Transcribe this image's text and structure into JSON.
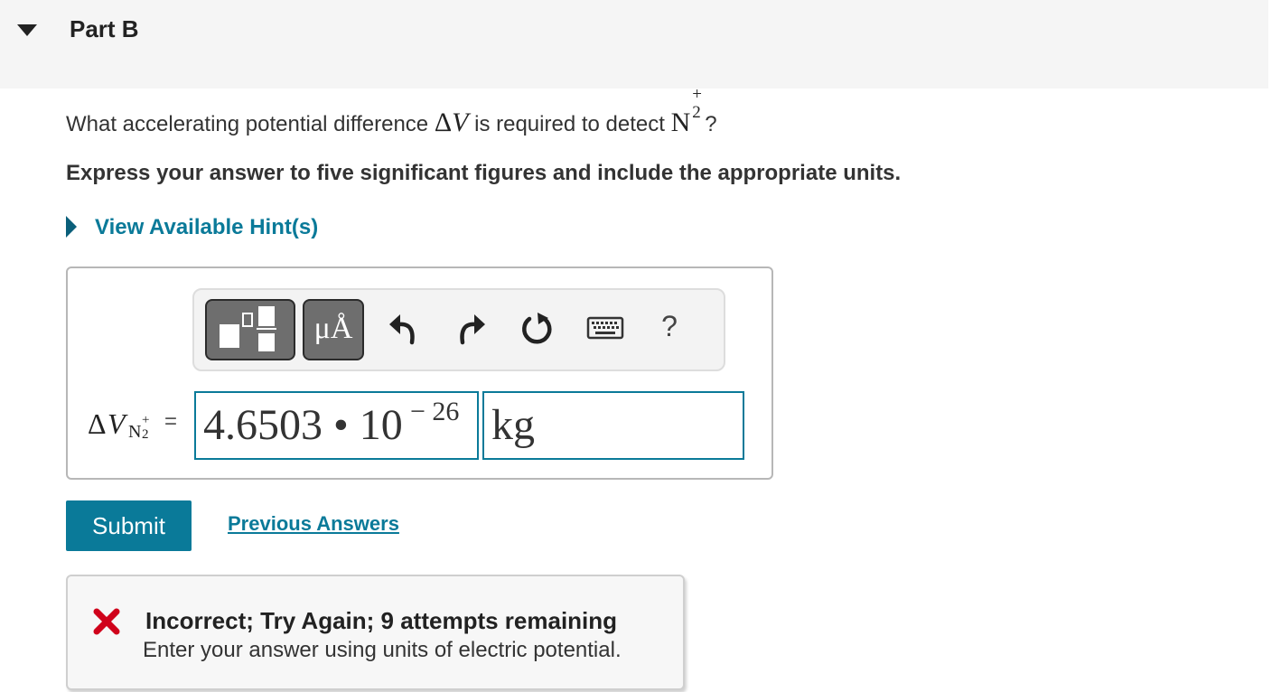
{
  "part": {
    "title": "Part B"
  },
  "question": {
    "text_before": "What accelerating potential difference",
    "delta_symbol": "Δ",
    "variable": "V",
    "text_middle": "is required to detect",
    "species_letter": "N",
    "species_charge": "+",
    "species_count": "2",
    "text_after": "?"
  },
  "instructions": "Express your answer to five significant figures and include the appropriate units.",
  "hint": {
    "label": "View Available Hint(s)"
  },
  "toolbar": {
    "units_glyph": "μÅ",
    "help_label": "?",
    "icons": [
      "templates-icon",
      "units-icon",
      "undo-icon",
      "redo-icon",
      "reset-icon",
      "keyboard-icon",
      "help-icon"
    ]
  },
  "answer": {
    "label_delta": "Δ",
    "label_variable": "V",
    "label_sub_letter": "N",
    "label_sub_charge": "+",
    "label_sub_count": "2",
    "equals": "=",
    "value_mantissa": "4.6503 • 10",
    "value_exponent": "− 26",
    "units_value": "kg"
  },
  "actions": {
    "submit_label": "Submit",
    "previous_answers_label": "Previous Answers"
  },
  "feedback": {
    "status": "incorrect",
    "title": "Incorrect; Try Again; 9 attempts remaining",
    "message": "Enter your answer using units of electric potential."
  },
  "colors": {
    "accent": "#0a7a99",
    "error": "#d0021b",
    "header_bg": "#f5f5f5",
    "toolbar_dark_button": "#6e6e6e"
  }
}
